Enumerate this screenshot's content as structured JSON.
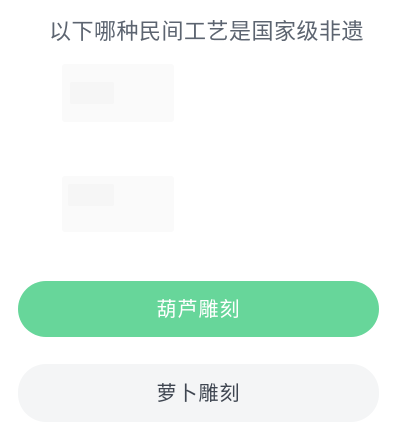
{
  "question": {
    "text": "以下哪种民间工艺是国家级非遗"
  },
  "options": [
    {
      "label": "葫芦雕刻",
      "state": "selected",
      "color": "#67d69a"
    },
    {
      "label": "萝卜雕刻",
      "state": "default",
      "color": "#f4f5f6"
    }
  ]
}
